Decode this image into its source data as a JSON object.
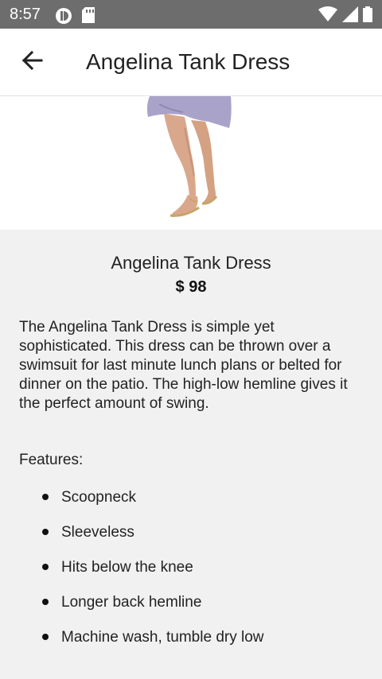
{
  "status_bar": {
    "time": "8:57"
  },
  "header": {
    "title": "Angelina Tank Dress"
  },
  "product": {
    "name": "Angelina Tank Dress",
    "price": "$ 98",
    "description": "The Angelina Tank Dress is simple yet sophisticated. This dress can be thrown over a swimsuit for last minute lunch plans or belted for dinner on the patio. The high-low hemline gives it the perfect amount of swing.",
    "features_label": "Features:",
    "features": [
      "Scoopneck",
      "Sleeveless",
      "Hits below the knee",
      "Longer back hemline",
      "Machine wash, tumble dry low"
    ]
  },
  "icons": {
    "back": "arrow-back-icon",
    "status": [
      "notification-icon",
      "sd-card-icon",
      "wifi-icon",
      "signal-icon",
      "battery-icon"
    ]
  },
  "colors": {
    "status_bar": "#6d6d6d",
    "app_bar": "#ffffff",
    "background": "#f1f1f1",
    "dress": "#a9a3c9"
  }
}
